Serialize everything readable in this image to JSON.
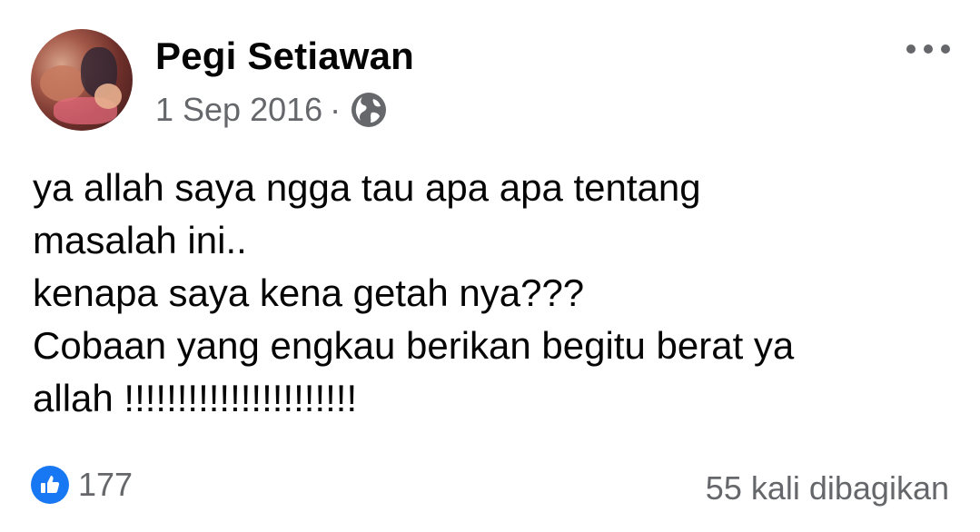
{
  "post": {
    "author_name": "Pegi Setiawan",
    "date": "1 Sep 2016",
    "separator": "·",
    "privacy_icon": "globe-icon",
    "more_icon": "more-options-icon",
    "text_lines": [
      "ya allah saya ngga tau apa apa tentang",
      "masalah ini..",
      "kenapa saya kena getah nya???",
      "Cobaan yang engkau berikan begitu berat ya",
      "allah !!!!!!!!!!!!!!!!!!!!!!"
    ],
    "reactions": {
      "icon": "like-icon",
      "count": "177"
    },
    "shares": "55 kali dibagikan"
  },
  "colors": {
    "text": "#050505",
    "secondary": "#65676b",
    "like_blue": "#1877f2"
  }
}
